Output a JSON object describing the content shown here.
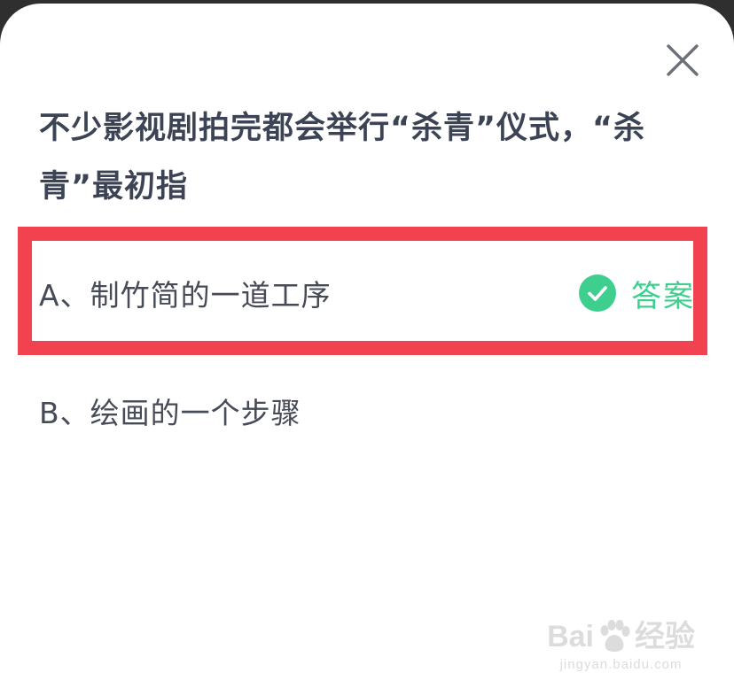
{
  "question": {
    "text": "不少影视剧拍完都会举行“杀青”仪式，“杀青”最初指"
  },
  "options": [
    {
      "label": "A、制竹简的一道工序",
      "is_answer": true
    },
    {
      "label": "B、绘画的一个步骤",
      "is_answer": false
    }
  ],
  "answer_tag": {
    "label": "答案",
    "icon": "check-circle-icon"
  },
  "close_icon": "close-icon",
  "watermark": {
    "brand_left": "Bai",
    "brand_right": "经验",
    "url": "jingyan.baidu.com"
  },
  "colors": {
    "accent_green": "#3ecf8e",
    "highlight_red": "#f2414f",
    "question_text": "#3b4354",
    "option_text": "#464b57"
  }
}
